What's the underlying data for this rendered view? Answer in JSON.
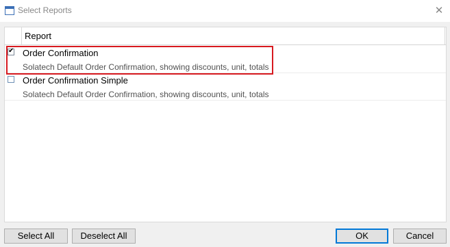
{
  "window": {
    "title": "Select Reports",
    "close_glyph": "✕"
  },
  "grid": {
    "column_header": "Report",
    "rows": [
      {
        "title": "Order Confirmation",
        "description": "Solatech Default Order Confirmation, showing discounts, unit, totals",
        "checked": true,
        "highlighted": true
      },
      {
        "title": "Order Confirmation Simple",
        "description": "Solatech Default Order Confirmation, showing discounts, unit, totals",
        "checked": false,
        "highlighted": false
      }
    ]
  },
  "buttons": {
    "select_all": "Select All",
    "deselect_all": "Deselect All",
    "ok": "OK",
    "cancel": "Cancel"
  },
  "colors": {
    "highlight_border": "#d7191f",
    "default_button_border": "#0078d7"
  },
  "icons": {
    "window_icon": "window-icon",
    "close_icon": "close-icon",
    "checkbox_checked": "checkbox-checked-icon",
    "checkbox_unchecked": "checkbox-unchecked-icon"
  }
}
